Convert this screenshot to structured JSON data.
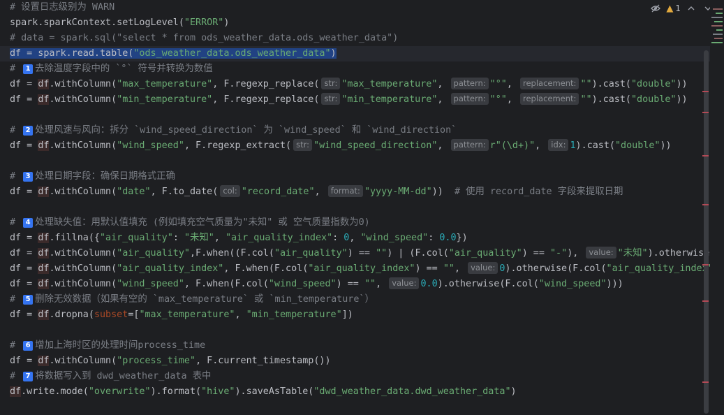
{
  "toolbar": {
    "warning_count": "1"
  },
  "lines": [
    {
      "type": "comment",
      "text": "# 设置日志级别为 WARN"
    },
    {
      "type": "call1",
      "v": "spark",
      "rest": ".sparkContext.setLogLevel(",
      "s1": "\"ERROR\"",
      "end": ")"
    },
    {
      "type": "comment",
      "text": "# data = spark.sql(\"select * from ods_weather_data.ods_weather_data\")"
    },
    {
      "type": "current",
      "text": "df = spark.read.table(\"ods_weather_data.ods_weather_data\")"
    },
    {
      "type": "badgecomment",
      "pre": "# ",
      "badge": "1",
      "text": "去除温度字段中的 `°` 符号并转换为数值"
    },
    {
      "type": "code",
      "text": "max_temp"
    },
    {
      "type": "code",
      "text": "min_temp"
    },
    {
      "type": "blank"
    },
    {
      "type": "badgecomment",
      "pre": "# ",
      "badge": "2",
      "text": "处理风速与风向：拆分 `wind_speed_direction` 为 `wind_speed` 和 `wind_direction`"
    },
    {
      "type": "code",
      "text": "wind_speed"
    },
    {
      "type": "blank"
    },
    {
      "type": "badgecomment",
      "pre": "# ",
      "badge": "3",
      "text": "处理日期字段：确保日期格式正确"
    },
    {
      "type": "code",
      "text": "date"
    },
    {
      "type": "blank"
    },
    {
      "type": "badgecomment",
      "pre": "# ",
      "badge": "4",
      "text": "处理缺失值：用默认值填充 (例如填充空气质量为\"未知\" 或 空气质量指数为0)"
    },
    {
      "type": "code",
      "text": "fillna"
    },
    {
      "type": "code",
      "text": "aq"
    },
    {
      "type": "code",
      "text": "aqi"
    },
    {
      "type": "code",
      "text": "ws2"
    },
    {
      "type": "badgecomment",
      "pre": "# ",
      "badge": "5",
      "text": "删除无效数据（如果有空的 `max_temperature` 或 `min_temperature`）"
    },
    {
      "type": "code",
      "text": "dropna"
    },
    {
      "type": "blank"
    },
    {
      "type": "badgecomment",
      "pre": "# ",
      "badge": "6",
      "text": "增加上海时区的处理时间process_time"
    },
    {
      "type": "code",
      "text": "ptime"
    },
    {
      "type": "badgecomment",
      "pre": "# ",
      "badge": "7",
      "text": "将数据写入到 dwd_weather_data 表中"
    },
    {
      "type": "code",
      "text": "write"
    }
  ],
  "code": {
    "df": "df",
    "eq": " = ",
    "max_temp": {
      "call": ".withColumn(",
      "s1": "\"max_temperature\"",
      "mid": ", F.regexp_replace(",
      "h1": "str:",
      "s2": "\"max_temperature\"",
      "h2": "pattern:",
      "s3": "\"°\"",
      "h3": "replacement:",
      "s4": "\"\"",
      "end": ").cast(",
      "s5": "\"double\"",
      "end2": "))"
    },
    "min_temp": {
      "call": ".withColumn(",
      "s1": "\"min_temperature\"",
      "mid": ", F.regexp_replace(",
      "h1": "str:",
      "s2": "\"min_temperature\"",
      "h2": "pattern:",
      "s3": "\"°\"",
      "h3": "replacement:",
      "s4": "\"\"",
      "end": ").cast(",
      "s5": "\"double\"",
      "end2": "))"
    },
    "wind_speed": {
      "call": ".withColumn(",
      "s1": "\"wind_speed\"",
      "mid": ", F.regexp_extract(",
      "h1": "str:",
      "s2": "\"wind_speed_direction\"",
      "h2": "pattern:",
      "s3": "r\"(\\d+)\"",
      "h3": "idx:",
      "n1": "1",
      "end": ").cast(",
      "s5": "\"double\"",
      "end2": "))"
    },
    "date": {
      "call": ".withColumn(",
      "s1": "\"date\"",
      "mid": ", F.to_date(",
      "h1": "col:",
      "s2": "\"record_date\"",
      "h2": "format:",
      "s3": "\"yyyy-MM-dd\"",
      "end": "))  ",
      "cm": "# 使用 record_date 字段来提取日期"
    },
    "fillna": {
      "call": ".fillna({",
      "s1": "\"air_quality\"",
      "c1": ": ",
      "s2": "\"未知\"",
      "c2": ", ",
      "s3": "\"air_quality_index\"",
      "c3": ": ",
      "n1": "0",
      "c4": ", ",
      "s4": "\"wind_speed\"",
      "c5": ": ",
      "n2": "0.0",
      "end": "})"
    },
    "aq": {
      "call": ".withColumn(",
      "s1": "\"air_quality\"",
      "mid": ",F.when((F.col(",
      "s2": "\"air_quality\"",
      "m2": ") == ",
      "s3": "\"\"",
      "m3": ") | (F.col(",
      "s4": "\"air_quality\"",
      "m4": ") == ",
      "s5": "\"-\"",
      "m5": "), ",
      "h1": "value:",
      "s6": "\"未知\"",
      "end": ").otherwise(F"
    },
    "aqi": {
      "call": ".withColumn(",
      "s1": "\"air_quality_index\"",
      "mid": ", F.when(F.col(",
      "s2": "\"air_quality_index\"",
      "m2": ") == ",
      "s3": "\"\"",
      "m3": ", ",
      "h1": "value:",
      "n1": "0",
      "end": ").otherwise(F.col(",
      "s4": "\"air_quality_index\"",
      "end2": ")"
    },
    "ws2": {
      "call": ".withColumn(",
      "s1": "\"wind_speed\"",
      "mid": ", F.when(F.col(",
      "s2": "\"wind_speed\"",
      "m2": ") == ",
      "s3": "\"\"",
      "m3": ", ",
      "h1": "value:",
      "n1": "0.0",
      "end": ").otherwise(F.col(",
      "s4": "\"wind_speed\"",
      "end2": ")))"
    },
    "dropna": {
      "call": ".dropna(",
      "p1": "subset",
      "c1": "=[",
      "s1": "\"max_temperature\"",
      "c2": ", ",
      "s2": "\"min_temperature\"",
      "end": "])"
    },
    "ptime": {
      "call": ".withColumn(",
      "s1": "\"process_time\"",
      "mid": ", F.current_timestamp())"
    },
    "write": {
      "call": ".write.mode(",
      "s1": "\"overwrite\"",
      "m1": ").format(",
      "s2": "\"hive\"",
      "m2": ").saveAsTable(",
      "s3": "\"dwd_weather_data.dwd_weather_data\"",
      "end": ")"
    }
  },
  "current": {
    "pre": "df = spark.read.table(",
    "s1": "\"ods_weather_data.ods_weather_data\"",
    "end": ")"
  },
  "colors": {
    "background": "#1e1f22",
    "string": "#6aab73",
    "comment": "#7a7e85",
    "number": "#2aacb8",
    "badge": "#3574f0"
  }
}
